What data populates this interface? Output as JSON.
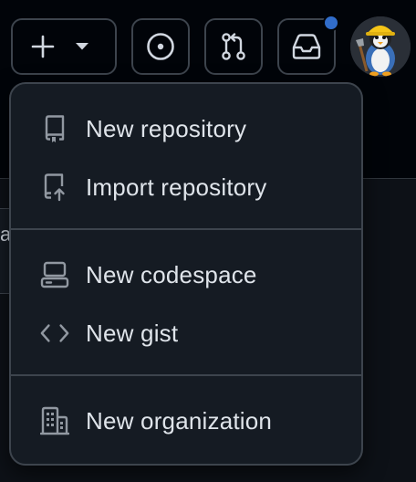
{
  "header": {
    "new_button_icon": "plus-icon",
    "new_button_caret_icon": "triangle-down-icon",
    "issues_icon": "issue-opened-icon",
    "pulls_icon": "git-pull-request-icon",
    "inbox_icon": "inbox-icon",
    "notification_indicator_color": "#316dca",
    "avatar_icon": "user-avatar"
  },
  "menu": {
    "items": [
      {
        "label": "New repository",
        "icon": "repo-icon"
      },
      {
        "label": "Import repository",
        "icon": "repo-push-icon"
      },
      {
        "label": "New codespace",
        "icon": "codespaces-icon"
      },
      {
        "label": "New gist",
        "icon": "code-icon"
      },
      {
        "label": "New organization",
        "icon": "organization-icon"
      }
    ]
  },
  "background": {
    "edge_text": "a"
  },
  "colors": {
    "page_bg": "#010409",
    "menu_bg": "#151b23",
    "border": "#3d444d",
    "text": "#dfe4ea",
    "accent": "#316dca"
  }
}
